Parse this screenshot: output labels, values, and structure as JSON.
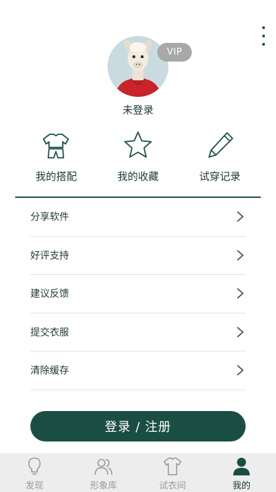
{
  "header": {
    "more_icon": "more-vertical-icon"
  },
  "profile": {
    "avatar_icon": "alpaca-avatar",
    "vip_label": "VIP",
    "username": "未登录"
  },
  "quick_actions": [
    {
      "label": "我的搭配",
      "icon": "outfit-icon"
    },
    {
      "label": "我的收藏",
      "icon": "star-icon"
    },
    {
      "label": "试穿记录",
      "icon": "pencil-icon"
    }
  ],
  "menu": [
    {
      "label": "分享软件"
    },
    {
      "label": "好评支持"
    },
    {
      "label": "建议反馈"
    },
    {
      "label": "提交衣服"
    },
    {
      "label": "清除缓存"
    }
  ],
  "login_button": "登录 / 注册",
  "tabs": [
    {
      "label": "发现",
      "icon": "lightbulb-icon",
      "active": false
    },
    {
      "label": "形象库",
      "icon": "people-icon",
      "active": false
    },
    {
      "label": "试衣间",
      "icon": "shirt-icon",
      "active": false
    },
    {
      "label": "我的",
      "icon": "person-icon",
      "active": true
    }
  ],
  "colors": {
    "primary": "#1b4e43",
    "text": "#1e3a33",
    "vip_badge": "#a8a8a8",
    "tabbar_bg": "#ededed",
    "tab_inactive": "#9a9a9a"
  }
}
